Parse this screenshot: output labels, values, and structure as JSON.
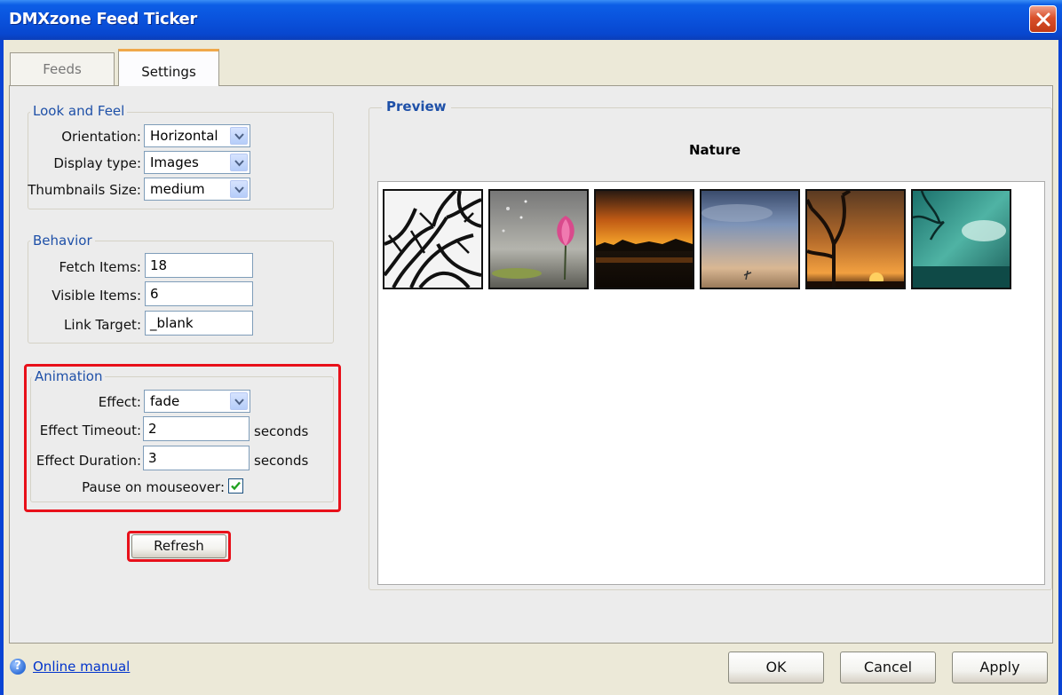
{
  "window": {
    "title": "DMXzone Feed Ticker"
  },
  "tabs": [
    {
      "label": "Feeds",
      "active": false
    },
    {
      "label": "Settings",
      "active": true
    }
  ],
  "look_and_feel": {
    "legend": "Look and Feel",
    "orientation": {
      "label": "Orientation:",
      "value": "Horizontal"
    },
    "display_type": {
      "label": "Display type:",
      "value": "Images"
    },
    "thumbnails_size": {
      "label": "Thumbnails Size:",
      "value": "medium"
    }
  },
  "behavior": {
    "legend": "Behavior",
    "fetch_items": {
      "label": "Fetch Items:",
      "value": "18"
    },
    "visible_items": {
      "label": "Visible Items:",
      "value": "6"
    },
    "link_target": {
      "label": "Link Target:",
      "value": "_blank"
    }
  },
  "animation": {
    "legend": "Animation",
    "effect": {
      "label": "Effect:",
      "value": "fade"
    },
    "effect_timeout": {
      "label": "Effect Timeout:",
      "value": "2",
      "unit": "seconds"
    },
    "effect_duration": {
      "label": "Effect Duration:",
      "value": "3",
      "unit": "seconds"
    },
    "pause_on_mouseover": {
      "label": "Pause on mouseover:",
      "checked": true
    }
  },
  "refresh_button": "Refresh",
  "preview": {
    "legend": "Preview",
    "feed_title": "Nature",
    "thumbnails": [
      "bare-branches",
      "pink-lotus",
      "orange-sunset",
      "blue-sky-dusk",
      "tree-sunset",
      "teal-sky-branches"
    ]
  },
  "footer": {
    "help_link": "Online manual",
    "ok": "OK",
    "cancel": "Cancel",
    "apply": "Apply"
  },
  "colors": {
    "titlebar": "#0a52dc",
    "highlight": "#e8101a",
    "legend_text": "#1e50a8",
    "tab_accent": "#f0a84a"
  }
}
